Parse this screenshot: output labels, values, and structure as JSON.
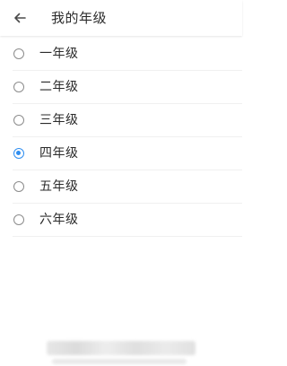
{
  "header": {
    "back_icon": "arrow-left-icon",
    "title": "我的年级"
  },
  "grades": {
    "selected_index": 3,
    "items": [
      {
        "label": "一年级",
        "selected": false
      },
      {
        "label": "二年级",
        "selected": false
      },
      {
        "label": "三年级",
        "selected": false
      },
      {
        "label": "四年级",
        "selected": true
      },
      {
        "label": "五年级",
        "selected": false
      },
      {
        "label": "六年级",
        "selected": false
      }
    ]
  },
  "colors": {
    "accent": "#2f8ef0",
    "text": "#2b2b2b",
    "radio_border": "#8c8c8c",
    "divider": "#f0f0f0"
  }
}
